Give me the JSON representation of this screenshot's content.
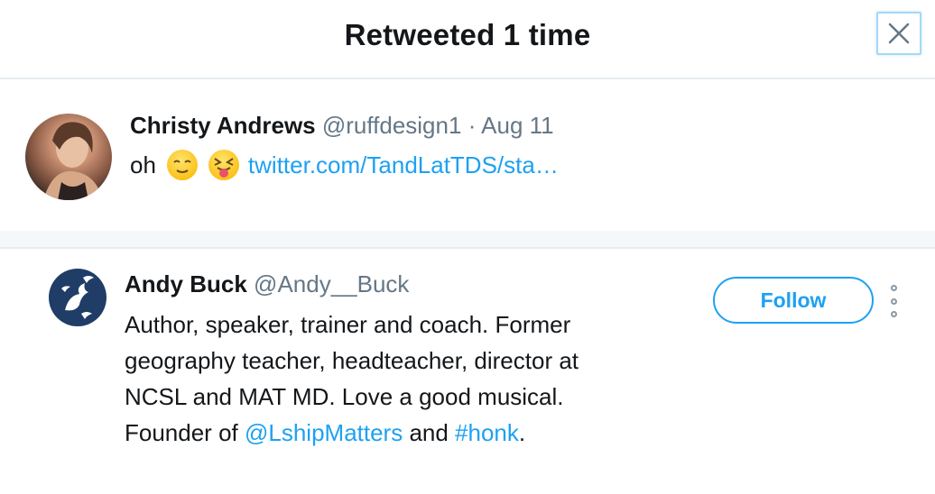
{
  "dialog": {
    "title": "Retweeted 1 time"
  },
  "tweet": {
    "author_name": "Christy Andrews",
    "author_handle": "@ruffdesign1",
    "separator": "·",
    "date": "Aug 11",
    "text": "oh",
    "emojis": [
      "relieved-face",
      "squinting-face-with-tongue"
    ],
    "link": "twitter.com/TandLatTDS/sta…"
  },
  "user": {
    "name": "Andy Buck",
    "handle": "@Andy__Buck",
    "bio_text_1": "Author, speaker, trainer and coach. Former geography teacher, headteacher, director at NCSL and MAT MD. Love a good musical. Founder of ",
    "bio_mention": "@LshipMatters",
    "bio_text_2": " and ",
    "bio_hashtag": "#honk",
    "bio_text_3": ".",
    "follow_label": "Follow"
  },
  "colors": {
    "accent": "#1da1f2",
    "muted_text": "#657786",
    "divider": "#e6ecf0"
  }
}
